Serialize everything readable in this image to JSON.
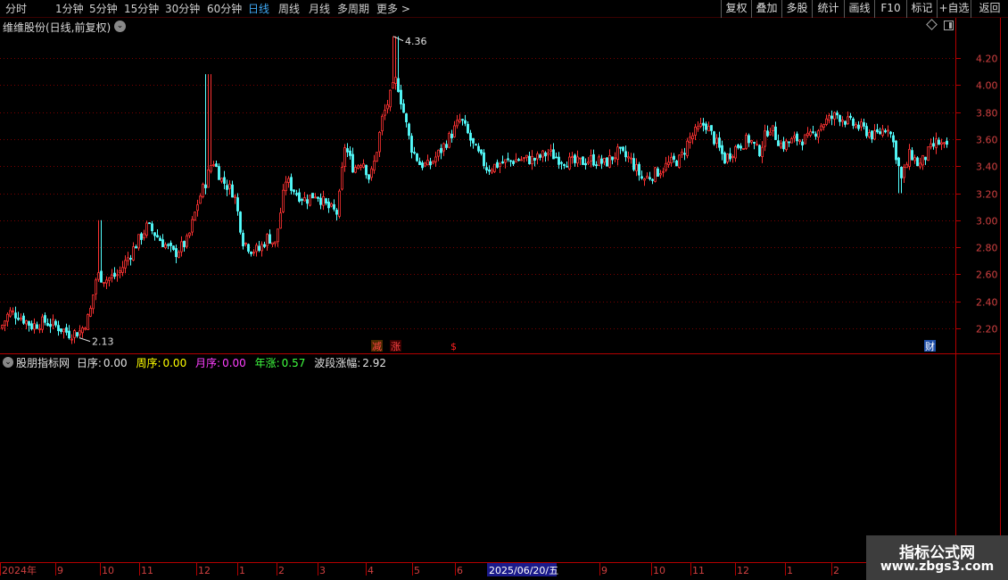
{
  "toolbar": {
    "periods": [
      {
        "label": "分时",
        "active": false
      },
      {
        "label": "1分钟",
        "active": false
      },
      {
        "label": "5分钟",
        "active": false
      },
      {
        "label": "15分钟",
        "active": false
      },
      {
        "label": "30分钟",
        "active": false
      },
      {
        "label": "60分钟",
        "active": false
      },
      {
        "label": "日线",
        "active": true
      },
      {
        "label": "周线",
        "active": false
      },
      {
        "label": "月线",
        "active": false
      },
      {
        "label": "多周期",
        "active": false
      },
      {
        "label": "更多 >",
        "active": false
      }
    ],
    "buttons": [
      "复权",
      "叠加",
      "多股",
      "统计",
      "画线",
      "F10",
      "标记",
      "+自选",
      "返回"
    ]
  },
  "chart": {
    "title": "维维股份(日线,前复权)",
    "price_axis": [
      "4.20",
      "4.00",
      "3.80",
      "3.60",
      "3.40",
      "3.20",
      "3.00",
      "2.80",
      "2.60",
      "2.40",
      "2.20"
    ],
    "high_label": "4.36",
    "low_label": "2.13",
    "markers": [
      {
        "text": "减",
        "color": "#ff4444",
        "bg": "#4a2a00"
      },
      {
        "text": "涨",
        "color": "#ff4444",
        "bg": "#3a0000"
      },
      {
        "text": "$",
        "color": "#ff2020",
        "bg": ""
      },
      {
        "text": "财",
        "color": "#ffffff",
        "bg": "#1f4fa8"
      }
    ]
  },
  "indicator": {
    "name": "股朋指标网",
    "day_label": "日序:",
    "day_value": "0.00",
    "week_label": "周序:",
    "week_value": "0.00",
    "month_label": "月序:",
    "month_value": "0.00",
    "year_label": "年涨:",
    "year_value": "0.57",
    "wave_label": "波段涨幅:",
    "wave_value": "2.92",
    "colors": {
      "day": "#e0e0e0",
      "week": "#ffff00",
      "month": "#ff40ff",
      "year": "#40ff40",
      "wave": "#e0e0e0"
    }
  },
  "date_axis": {
    "labels": [
      "2024年",
      "9",
      "10",
      "11",
      "12",
      "1",
      "2",
      "3",
      "4",
      "5",
      "6",
      "9",
      "10",
      "11",
      "12",
      "1",
      "2"
    ],
    "cursor_date": "2025/06/20/五"
  },
  "watermark": {
    "title": "指标公式网",
    "url": "www.zbgs3.com"
  },
  "colors": {
    "up": "#ff3232",
    "down": "#54ffff",
    "frame": "#b40000",
    "grid": "#7a0000",
    "axis_text": "#d04040"
  },
  "chart_data": {
    "type": "candlestick",
    "title": "维维股份(日线,前复权)",
    "ylim": [
      2.1,
      4.4
    ],
    "ticks": [
      2.2,
      2.4,
      2.6,
      2.8,
      3.0,
      3.2,
      3.4,
      3.6,
      3.8,
      4.0,
      4.2
    ],
    "keypoints": [
      [
        0,
        2.2
      ],
      [
        10,
        2.32
      ],
      [
        20,
        2.3
      ],
      [
        35,
        2.22
      ],
      [
        50,
        2.25
      ],
      [
        62,
        2.22
      ],
      [
        78,
        2.16
      ],
      [
        90,
        2.18
      ],
      [
        100,
        2.3
      ],
      [
        108,
        2.6
      ],
      [
        118,
        2.56
      ],
      [
        132,
        2.6
      ],
      [
        150,
        2.8
      ],
      [
        165,
        2.96
      ],
      [
        180,
        2.85
      ],
      [
        195,
        2.75
      ],
      [
        210,
        2.85
      ],
      [
        222,
        3.15
      ],
      [
        230,
        3.28
      ],
      [
        238,
        3.45
      ],
      [
        248,
        3.3
      ],
      [
        262,
        3.2
      ],
      [
        272,
        2.85
      ],
      [
        282,
        2.78
      ],
      [
        290,
        2.78
      ],
      [
        300,
        2.88
      ],
      [
        308,
        2.82
      ],
      [
        320,
        3.3
      ],
      [
        332,
        3.2
      ],
      [
        342,
        3.15
      ],
      [
        354,
        3.2
      ],
      [
        366,
        3.1
      ],
      [
        378,
        3.05
      ],
      [
        386,
        3.55
      ],
      [
        396,
        3.38
      ],
      [
        406,
        3.45
      ],
      [
        414,
        3.3
      ],
      [
        420,
        3.45
      ],
      [
        428,
        3.75
      ],
      [
        436,
        3.9
      ],
      [
        444,
        4.05
      ],
      [
        452,
        3.8
      ],
      [
        460,
        3.55
      ],
      [
        470,
        3.42
      ],
      [
        480,
        3.4
      ],
      [
        492,
        3.5
      ],
      [
        504,
        3.62
      ],
      [
        516,
        3.75
      ],
      [
        530,
        3.55
      ],
      [
        546,
        3.38
      ],
      [
        560,
        3.42
      ],
      [
        580,
        3.45
      ],
      [
        600,
        3.45
      ],
      [
        614,
        3.5
      ],
      [
        628,
        3.45
      ],
      [
        645,
        3.42
      ],
      [
        662,
        3.45
      ],
      [
        678,
        3.42
      ],
      [
        692,
        3.5
      ],
      [
        706,
        3.45
      ],
      [
        720,
        3.3
      ],
      [
        735,
        3.35
      ],
      [
        750,
        3.42
      ],
      [
        762,
        3.45
      ],
      [
        772,
        3.6
      ],
      [
        790,
        3.72
      ],
      [
        800,
        3.6
      ],
      [
        812,
        3.45
      ],
      [
        826,
        3.55
      ],
      [
        840,
        3.6
      ],
      [
        850,
        3.5
      ],
      [
        862,
        3.7
      ],
      [
        876,
        3.55
      ],
      [
        892,
        3.6
      ],
      [
        906,
        3.6
      ],
      [
        922,
        3.72
      ],
      [
        938,
        3.78
      ],
      [
        952,
        3.72
      ],
      [
        966,
        3.68
      ],
      [
        980,
        3.62
      ],
      [
        995,
        3.7
      ],
      [
        1002,
        3.55
      ],
      [
        1010,
        3.3
      ],
      [
        1020,
        3.5
      ],
      [
        1030,
        3.4
      ],
      [
        1040,
        3.5
      ],
      [
        1050,
        3.58
      ],
      [
        1062,
        3.52
      ]
    ],
    "high": {
      "value": 4.36
    },
    "low": {
      "value": 2.13
    }
  }
}
